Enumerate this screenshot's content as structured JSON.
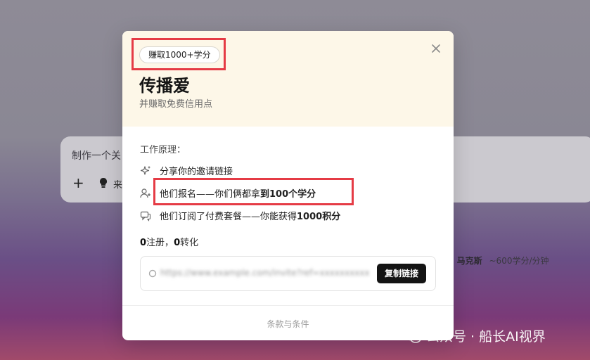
{
  "background": {
    "prompt_text": "制作一个关",
    "add_icon": "plus-icon",
    "suggestion_icon": "lightbulb-icon",
    "suggestion_text": "来",
    "model_name": "马克斯",
    "model_rate": "~600学分/分钟",
    "watermark": "公众号 · 船长AI视界"
  },
  "modal": {
    "badge": "赚取1000+学分",
    "title": "传播爱",
    "subtitle": "并赚取免费信用点",
    "section_label": "工作原理：",
    "steps": [
      {
        "icon": "sparkle-icon",
        "text": "分享你的邀请链接",
        "bold": ""
      },
      {
        "icon": "user-add-icon",
        "text": "他们报名——你们俩都拿",
        "bold": "到100个学分"
      },
      {
        "icon": "chat-icon",
        "text": "他们订阅了付费套餐——你能获得",
        "bold": "1000积分"
      }
    ],
    "stats": {
      "signups": "0",
      "signups_label": "注册，",
      "conversions": "0",
      "conversions_label": "转化"
    },
    "link_placeholder": "https://www.example.com/invite?ref=xxxxxxxxxx",
    "copy_button": "复制链接",
    "footer": "条款与条件"
  },
  "colors": {
    "highlight_border": "#e53b45",
    "header_bg": "#fdf7e8",
    "button_bg": "#141414"
  }
}
